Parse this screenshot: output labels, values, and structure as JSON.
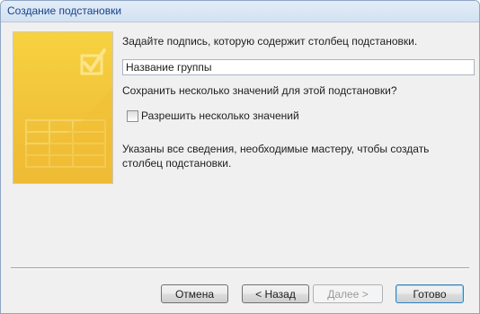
{
  "window": {
    "title": "Создание подстановки"
  },
  "prompt": "Задайте подпись, которую содержит столбец подстановки.",
  "label_field": {
    "value": "Название группы"
  },
  "multivalue": {
    "question": "Сохранить несколько значений для этой подстановки?",
    "checkbox_label": "Разрешить несколько значений",
    "checked": false
  },
  "info_text": "Указаны все сведения, необходимые мастеру, чтобы создать столбец подстановки.",
  "buttons": {
    "cancel": "Отмена",
    "back": "< Назад",
    "next": "Далее >",
    "finish": "Готово"
  },
  "colors": {
    "banner": "#f1c33a",
    "title_text": "#15428b"
  }
}
